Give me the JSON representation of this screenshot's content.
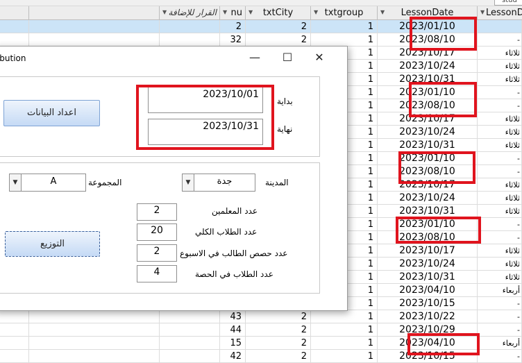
{
  "grid": {
    "tab_fragment": "stud",
    "columns": [
      {
        "key": "extra",
        "label": ""
      },
      {
        "key": "addQ",
        "label": "القرار للإضافة"
      },
      {
        "key": "nu",
        "label": "nu"
      },
      {
        "key": "city",
        "label": "txtCity"
      },
      {
        "key": "group",
        "label": "txtgroup"
      },
      {
        "key": "date",
        "label": "LessonDate"
      },
      {
        "key": "lesson",
        "label": "LessonD"
      }
    ],
    "rows": [
      {
        "nu": "2",
        "city": "2",
        "group": "1",
        "date": "2023/01/10",
        "ls": "",
        "sel": true
      },
      {
        "nu": "32",
        "city": "2",
        "group": "1",
        "date": "2023/08/10",
        "ls": "-"
      },
      {
        "nu": "",
        "city": "",
        "group": "1",
        "date": "2023/10/17",
        "ls": "ثلاثاء"
      },
      {
        "nu": "",
        "city": "",
        "group": "1",
        "date": "2023/10/24",
        "ls": "ثلاثاء"
      },
      {
        "nu": "",
        "city": "",
        "group": "1",
        "date": "2023/10/31",
        "ls": "ثلاثاء"
      },
      {
        "nu": "",
        "city": "",
        "group": "1",
        "date": "2023/01/10",
        "ls": "-"
      },
      {
        "nu": "",
        "city": "",
        "group": "1",
        "date": "2023/08/10",
        "ls": "-"
      },
      {
        "nu": "",
        "city": "",
        "group": "1",
        "date": "2023/10/17",
        "ls": "ثلاثاء"
      },
      {
        "nu": "",
        "city": "",
        "group": "1",
        "date": "2023/10/24",
        "ls": "ثلاثاء"
      },
      {
        "nu": "",
        "city": "",
        "group": "1",
        "date": "2023/10/31",
        "ls": "ثلاثاء"
      },
      {
        "nu": "",
        "city": "",
        "group": "1",
        "date": "2023/01/10",
        "ls": "-"
      },
      {
        "nu": "",
        "city": "",
        "group": "1",
        "date": "2023/08/10",
        "ls": "-"
      },
      {
        "nu": "",
        "city": "",
        "group": "1",
        "date": "2023/10/17",
        "ls": "ثلاثاء"
      },
      {
        "nu": "",
        "city": "",
        "group": "1",
        "date": "2023/10/24",
        "ls": "ثلاثاء"
      },
      {
        "nu": "",
        "city": "",
        "group": "1",
        "date": "2023/10/31",
        "ls": "ثلاثاء"
      },
      {
        "nu": "",
        "city": "",
        "group": "1",
        "date": "2023/01/10",
        "ls": "-"
      },
      {
        "nu": "",
        "city": "",
        "group": "1",
        "date": "2023/08/10",
        "ls": "-"
      },
      {
        "nu": "",
        "city": "",
        "group": "1",
        "date": "2023/10/17",
        "ls": "ثلاثاء"
      },
      {
        "nu": "",
        "city": "",
        "group": "1",
        "date": "2023/10/24",
        "ls": "ثلاثاء"
      },
      {
        "nu": "",
        "city": "",
        "group": "1",
        "date": "2023/10/31",
        "ls": "ثلاثاء"
      },
      {
        "nu": "",
        "city": "",
        "group": "1",
        "date": "2023/04/10",
        "ls": "أربعاء"
      },
      {
        "nu": "",
        "city": "",
        "group": "1",
        "date": "2023/10/15",
        "ls": "-"
      },
      {
        "nu": "43",
        "city": "2",
        "group": "1",
        "date": "2023/10/22",
        "ls": "-"
      },
      {
        "nu": "44",
        "city": "2",
        "group": "1",
        "date": "2023/10/29",
        "ls": "-"
      },
      {
        "nu": "15",
        "city": "2",
        "group": "1",
        "date": "2023/04/10",
        "ls": "أربعاء"
      },
      {
        "nu": "42",
        "city": "2",
        "group": "1",
        "date": "2023/10/15",
        "ls": "-"
      }
    ],
    "highlight_color": "#e0141e",
    "selected_row_color": "#cce4f7"
  },
  "dialog": {
    "title": "ribution",
    "controls": {
      "minimize": "—",
      "maximize": "☐",
      "close": "✕"
    },
    "start_label": "بداية",
    "end_label": "نهاية",
    "start_date": "2023/10/01",
    "end_date": "2023/10/31",
    "prepare_button": "اعداد البيانات",
    "city_label": "المدينة",
    "city_value": "جدة",
    "group_label": "المجموعة",
    "group_value": "A",
    "teachers_label": "عدد المعلمين",
    "teachers_value": "2",
    "total_students_label": "عدد الطلاب الكلي",
    "total_students_value": "20",
    "weekly_lessons_label": "عدد حصص الطالب في الاسبوع",
    "weekly_lessons_value": "2",
    "students_per_lesson_label": "عدد الطلاب في الحصة",
    "students_per_lesson_value": "4",
    "distribute_button": "التوزيع"
  }
}
